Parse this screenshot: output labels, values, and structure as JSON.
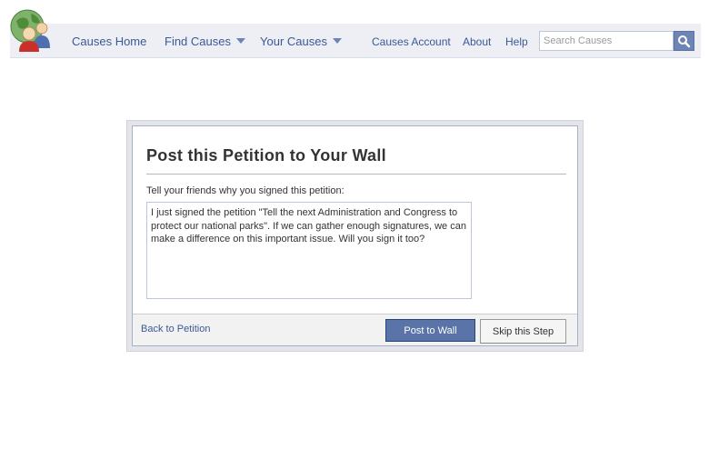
{
  "nav": {
    "home": "Causes Home",
    "find": "Find Causes",
    "yours": "Your Causes",
    "account": "Causes Account",
    "about": "About",
    "help": "Help",
    "search_placeholder": "Search Causes"
  },
  "dialog": {
    "title": "Post this Petition to Your Wall",
    "prompt": "Tell your friends why you signed this petition:",
    "message": "I just signed the petition \"Tell the next Administration and Congress to protect our national parks\". If we can gather enough signatures, we can make a difference on this important issue. Will you sign it too?",
    "back_link": "Back to Petition",
    "post_button": "Post to Wall",
    "skip_button": "Skip this Step"
  },
  "colors": {
    "link": "#3b5998",
    "navbar_bg": "#edeff4",
    "primary_button": "#5b74a8"
  }
}
